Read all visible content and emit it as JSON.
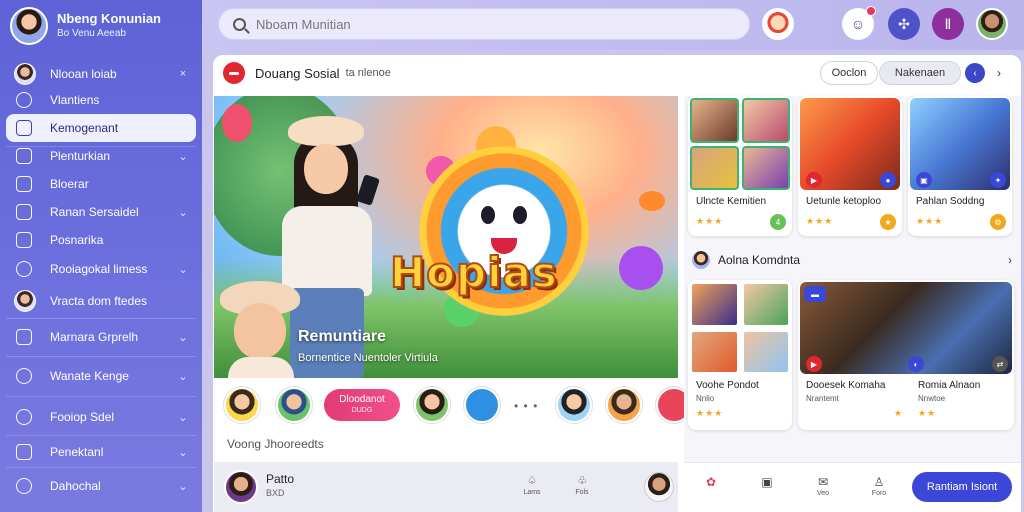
{
  "sidebar": {
    "profile_name": "Nbeng Konunian",
    "profile_sub": "Bo Venu Aeeab",
    "items": [
      {
        "label": "Nlooan loiab",
        "icon": "avatar-icon",
        "chevron": "×"
      },
      {
        "label": "Vlantiens",
        "icon": "circle-icon",
        "chevron": ""
      },
      {
        "label": "Kemogenant",
        "icon": "square-icon",
        "chevron": ""
      },
      {
        "label": "Plenturkian",
        "icon": "square-icon",
        "chevron": "⌄"
      },
      {
        "label": "Bloerar",
        "icon": "square-icon",
        "chevron": ""
      },
      {
        "label": "Ranan Sersaidel",
        "icon": "square-icon",
        "chevron": "⌄"
      },
      {
        "label": "Posnarika",
        "icon": "square-icon",
        "chevron": ""
      },
      {
        "label": "Rooiagokal limess",
        "icon": "circle-icon",
        "chevron": "⌄"
      },
      {
        "label": "Vracta dom ftedes",
        "icon": "avatar-icon",
        "chevron": ""
      },
      {
        "label": "Marnara Grprelh",
        "icon": "square-icon",
        "chevron": "⌄"
      },
      {
        "label": "Wanate Kenge",
        "icon": "circle-icon",
        "chevron": "⌄"
      },
      {
        "label": "Fooiop Sdel",
        "icon": "circle-icon",
        "chevron": "⌄"
      },
      {
        "label": "Penektanl",
        "icon": "square-icon",
        "chevron": "⌄"
      },
      {
        "label": "Dahochal",
        "icon": "circle-icon",
        "chevron": "⌄"
      }
    ]
  },
  "topbar": {
    "search_placeholder": "Nboam Munitian",
    "chat_badge": "•",
    "game_icon": "✣",
    "pause_icon": "Ⅱ"
  },
  "main": {
    "title": "Douang Sosial",
    "title_sub": "ta nlenoe",
    "pill1": "Ooclon",
    "pill2": "Nakenaen",
    "btn_next": "›",
    "btn_cycle": "‹",
    "hero_word": "Hopias",
    "hero_title": "Remuntiare",
    "hero_sub": "Bornentice Nuentoler Virtiula",
    "strip_pill_1": "Dloodanot",
    "strip_pill_2": "DUDG",
    "strip_dots": "• • •",
    "vlabel": "Voong Jhooreedts",
    "bottom_name": "Patto",
    "bottom_sub": "BXD",
    "bottom_icon1": "Lams",
    "bottom_icon2": "Fols"
  },
  "right": {
    "cards_top": [
      {
        "name": "Ulncte Kemitien",
        "stars": "★★★",
        "badge": "4"
      },
      {
        "name": "Uetunle ketoploo",
        "stars": "★★★",
        "badge": "★"
      },
      {
        "name": "Pahlan Soddng",
        "stars": "★★★",
        "badge": "⚙"
      }
    ],
    "section_title": "Aolna Komdnta",
    "section_chevron": "›",
    "cards_bottom": [
      {
        "name": "Voohe Pondot",
        "sub": "Nnlio",
        "stars": "★★★"
      },
      {
        "name": "Dooesek Komaha",
        "sub": "Nrantemt",
        "stars": "★"
      },
      {
        "name": "Romia Alnaon",
        "sub": "Nnwtoe",
        "stars": "★★"
      }
    ],
    "bar_icons": [
      {
        "label": "",
        "glyph": "✿"
      },
      {
        "label": "",
        "glyph": "▣"
      },
      {
        "label": "Veo",
        "glyph": "✉"
      },
      {
        "label": "Foro",
        "glyph": "♙"
      }
    ],
    "bar_button": "Rantiam Isiont"
  },
  "colors": {
    "sidebar": "#6468da",
    "accent": "#3b47d6",
    "live": "#e0262e",
    "pink": "#e23a74"
  }
}
